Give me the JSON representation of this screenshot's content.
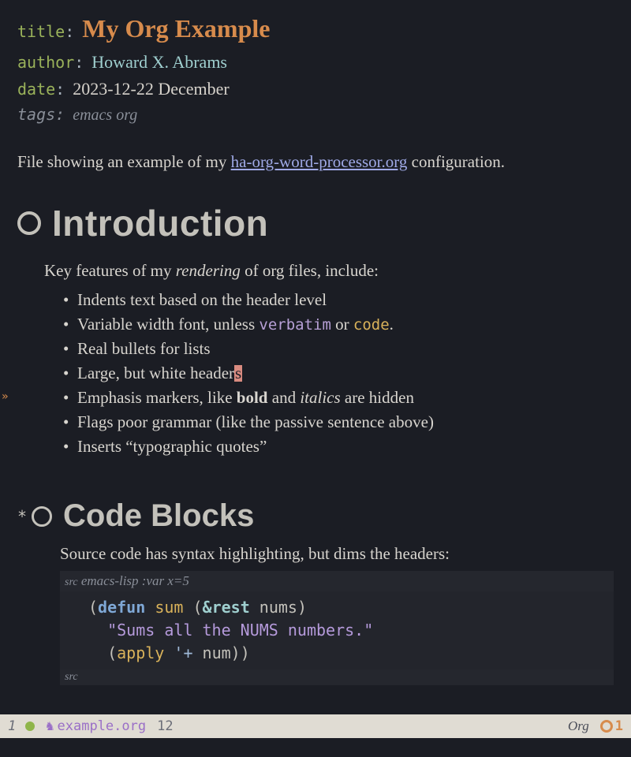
{
  "meta": {
    "title_key": "title",
    "title_val": "My Org Example",
    "author_key": "author",
    "author_val": "Howard X. Abrams",
    "date_key": "date",
    "date_val": "2023-12-22 December",
    "tags_key": "tags:",
    "tags_val": "emacs org"
  },
  "intro": {
    "pre": "File showing an example of my ",
    "link": "ha-org-word-processor.org",
    "post": " configuration."
  },
  "h1": "Introduction",
  "features_intro_pre": "Key features of my ",
  "features_intro_em": "rendering",
  "features_intro_post": " of org files, include:",
  "bullets": {
    "b1": "Indents text based on the header level",
    "b2_pre": "Variable width font, unless ",
    "b2_verbatim": "verbatim",
    "b2_mid": " or ",
    "b2_code": "code",
    "b2_post": ".",
    "b3": "Real bullets for lists",
    "b4_pre": "Large, but white header",
    "b4_cursor": "s",
    "b5_pre": "Emphasis markers, like ",
    "b5_bold": "bold",
    "b5_mid": " and ",
    "b5_italic": "italics",
    "b5_post": " are hidden",
    "b6": "Flags poor grammar (like the passive sentence above)",
    "b7": "Inserts “typographic quotes”"
  },
  "h2_star": "*",
  "h2": "Code Blocks",
  "code_intro": "Source code has syntax highlighting, but dims the headers:",
  "src_header_label": "src",
  "src_header_lang": " emacs-lisp :var x=5",
  "code": {
    "l1_open": "(",
    "l1_kw": "defun",
    "l1_sp1": " ",
    "l1_fn": "sum",
    "l1_sp2": " ",
    "l1_popen": "(",
    "l1_amp": "&rest",
    "l1_sp3": " ",
    "l1_arg": "nums",
    "l1_pclose": ")",
    "l2_indent": "  ",
    "l2_str": "\"Sums all the NUMS numbers.\"",
    "l3_indent": "  ",
    "l3_open": "(",
    "l3_fn": "apply",
    "l3_sp": " ",
    "l3_sym": "'+",
    "l3_sp2": " ",
    "l3_arg": "num",
    "l3_close": "))"
  },
  "src_footer": "src",
  "modeline": {
    "window": "1",
    "horse": "♞",
    "file": "example.org",
    "line": "12",
    "mode": "Org",
    "warn_count": "1"
  }
}
